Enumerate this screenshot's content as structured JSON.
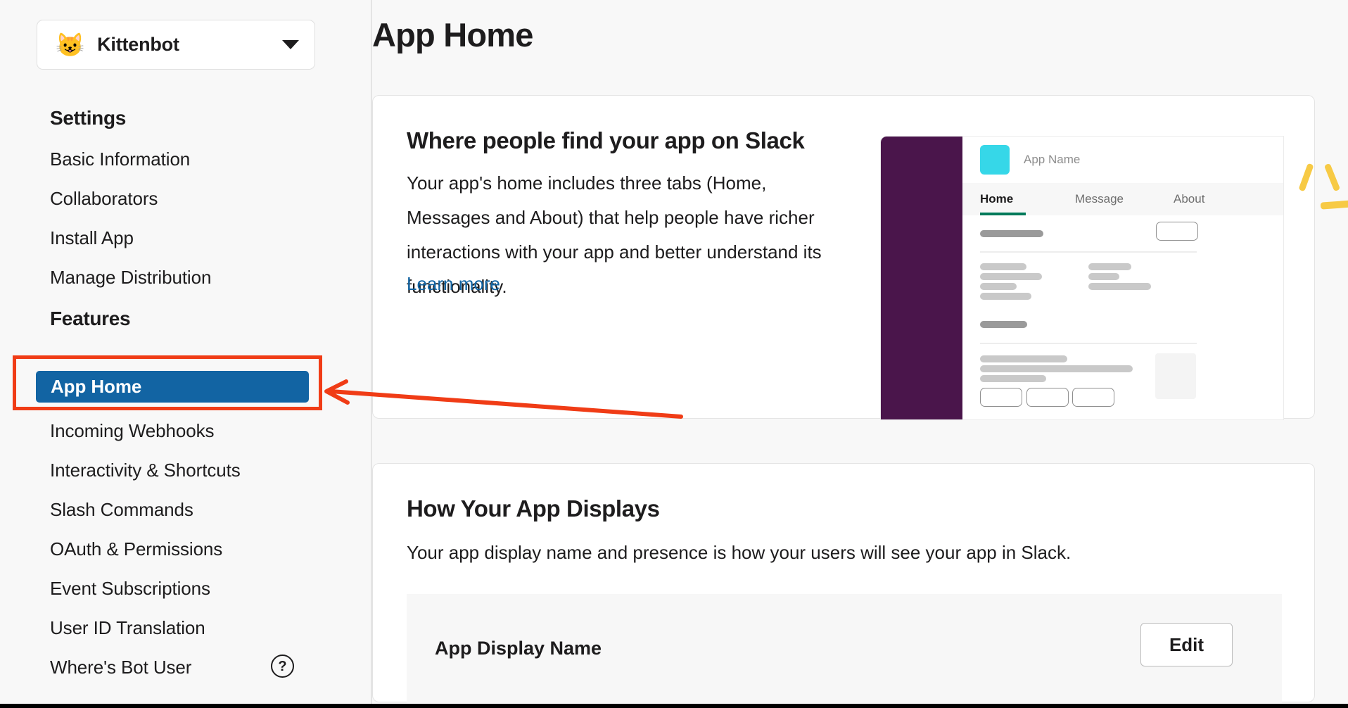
{
  "sidebar": {
    "app_selector": {
      "emoji": "😺",
      "name": "Kittenbot",
      "caret": "chevron-down-icon"
    },
    "sections": [
      {
        "heading": "Settings",
        "items": [
          {
            "label": "Basic Information"
          },
          {
            "label": "Collaborators"
          },
          {
            "label": "Install App"
          },
          {
            "label": "Manage Distribution"
          }
        ]
      },
      {
        "heading": "Features",
        "items": [
          {
            "label": "App Home",
            "active": true
          },
          {
            "label": "Incoming Webhooks"
          },
          {
            "label": "Interactivity & Shortcuts"
          },
          {
            "label": "Slash Commands"
          },
          {
            "label": "OAuth & Permissions"
          },
          {
            "label": "Event Subscriptions"
          },
          {
            "label": "User ID Translation"
          },
          {
            "label": "Where's Bot User"
          }
        ]
      }
    ],
    "help_icon_label": "?"
  },
  "main": {
    "page_title": "App Home",
    "cards": [
      {
        "title": "Where people find your app on Slack",
        "body": "Your app's home includes three tabs (Home, Messages and About) that help people have richer interactions with your app and better understand its functionality.",
        "link": "Learn more"
      },
      {
        "title": "How Your App Displays",
        "body": "Your app display name and presence is how your users will see your app in Slack.",
        "row_label": "App Display Name",
        "edit_label": "Edit"
      }
    ]
  },
  "illustration": {
    "app_name": "App Name",
    "tabs": [
      "Home",
      "Message",
      "About"
    ],
    "active_tab": "Home"
  },
  "colors": {
    "accent_blue": "#1264a3",
    "annotation_red": "#f03c16",
    "slack_aubergine": "#4a154b",
    "app_icon_cyan": "#36d7e8",
    "tab_green": "#007a5a",
    "sparkle_yellow": "#f7ca45",
    "page_background": "#f8f8f8"
  }
}
